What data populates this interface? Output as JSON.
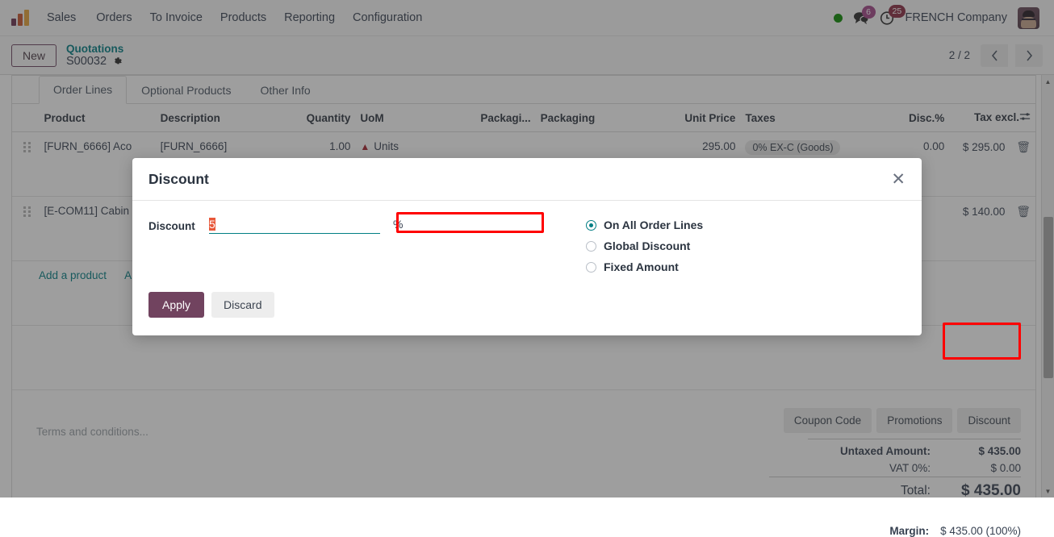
{
  "navbar": {
    "app_name": "Sales",
    "menu": [
      "Orders",
      "To Invoice",
      "Products",
      "Reporting",
      "Configuration"
    ],
    "messages_count": "6",
    "activities_count": "25",
    "company": "FRENCH Company",
    "status_color": "#0b8a00"
  },
  "control_panel": {
    "new_button": "New",
    "breadcrumb_parent": "Quotations",
    "breadcrumb_current": "S00032",
    "pager": "2 / 2"
  },
  "tabs": [
    {
      "label": "Order Lines",
      "active": true
    },
    {
      "label": "Optional Products",
      "active": false
    },
    {
      "label": "Other Info",
      "active": false
    }
  ],
  "table": {
    "headers": [
      "Product",
      "Description",
      "Quantity",
      "UoM",
      "Packagi...",
      "Packaging",
      "Unit Price",
      "Taxes",
      "Disc.%",
      "Tax excl."
    ],
    "rows": [
      {
        "product": "[FURN_6666] Aco",
        "description": "[FURN_6666]",
        "quantity": "1.00",
        "uom": "Units",
        "packaging_qty": "",
        "packaging": "",
        "unit_price": "295.00",
        "taxes": "0% EX-C (Goods)",
        "discount": "0.00",
        "tax_excl": "$ 295.00"
      },
      {
        "product": "[E-COM11] Cabin",
        "description": "",
        "quantity": "",
        "uom": "",
        "packaging_qty": "",
        "packaging": "",
        "unit_price": "",
        "taxes": "",
        "discount": "",
        "tax_excl": "$ 140.00"
      }
    ],
    "add_links": [
      "Add a product",
      "A"
    ]
  },
  "terms_placeholder": "Terms and conditions...",
  "promo_buttons": [
    "Coupon Code",
    "Promotions",
    "Discount"
  ],
  "totals": [
    {
      "label": "Untaxed Amount:",
      "value": "$ 435.00"
    },
    {
      "label": "VAT 0%:",
      "value": "$ 0.00"
    }
  ],
  "total_row": {
    "label": "Total:",
    "value": "$ 435.00"
  },
  "margin": {
    "label": "Margin:",
    "value": "$ 435.00 (100%)"
  },
  "modal": {
    "title": "Discount",
    "close_icon": "close-icon",
    "field_label": "Discount",
    "field_value": "5",
    "percent_symbol": "%",
    "options": [
      {
        "label": "On All Order Lines",
        "checked": true
      },
      {
        "label": "Global Discount",
        "checked": false
      },
      {
        "label": "Fixed Amount",
        "checked": false
      }
    ],
    "apply_label": "Apply",
    "discard_label": "Discard"
  },
  "colors": {
    "accent_teal": "#017e84",
    "primary_purple": "#71435f",
    "highlight_red": "#ff0000",
    "selection_orange": "#e8583a"
  }
}
